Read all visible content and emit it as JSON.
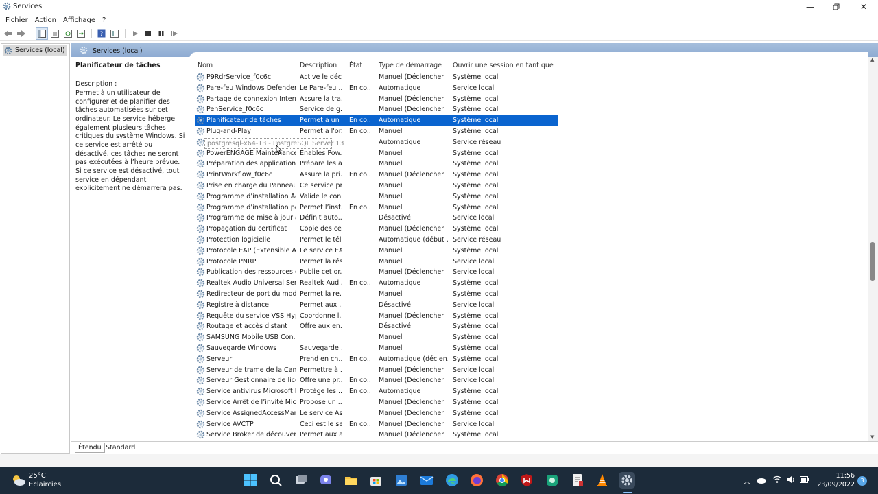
{
  "window": {
    "title": "Services"
  },
  "menu": [
    "Fichier",
    "Action",
    "Affichage",
    "?"
  ],
  "tree": {
    "node_label": "Services (local)"
  },
  "header_bar": {
    "label": "Services (local)"
  },
  "description_panel": {
    "title": "Planificateur de tâches",
    "desc_label": "Description :",
    "desc_text": "Permet à un utilisateur de configurer et de planifier des tâches automatisées sur cet ordinateur. Le service héberge également plusieurs tâches critiques du système Windows. Si ce service est arrêté ou désactivé, ces tâches ne seront pas exécutées à l’heure prévue. Si ce service est désactivé, tout service en dépendant explicitement ne démarrera pas."
  },
  "columns": [
    "Nom",
    "Description",
    "État",
    "Type de démarrage",
    "Ouvrir une session en tant que"
  ],
  "rows": [
    [
      "P9RdrService_f0c6c",
      "Active le déc...",
      "",
      "Manuel (Déclencher l...",
      "Système local"
    ],
    [
      "Pare-feu Windows Defender",
      "Le Pare-feu ...",
      "En co...",
      "Automatique",
      "Service local"
    ],
    [
      "Partage de connexion Intern...",
      "Assure la tra...",
      "",
      "Manuel (Déclencher l...",
      "Système local"
    ],
    [
      "PenService_f0c6c",
      "Service de g...",
      "",
      "Manuel (Déclencher l...",
      "Système local"
    ],
    [
      "Planificateur de tâches",
      "Permet à un ...",
      "En co...",
      "Automatique",
      "Système local"
    ],
    [
      "Plug-and-Play",
      "Permet à l'or...",
      "En co...",
      "Manuel",
      "Système local"
    ],
    [
      "",
      "",
      "",
      "Automatique",
      "Service réseau"
    ],
    [
      "PowerENGAGE Maintenance...",
      "Enables Pow...",
      "",
      "Manuel",
      "Système local"
    ],
    [
      "Préparation des applications",
      "Prépare les a...",
      "",
      "Manuel",
      "Système local"
    ],
    [
      "PrintWorkflow_f0c6c",
      "Assure la pri...",
      "En co...",
      "Manuel (Déclencher l...",
      "Système local"
    ],
    [
      "Prise en charge du Panneau ...",
      "Ce service pr...",
      "",
      "Manuel",
      "Système local"
    ],
    [
      "Programme d’installation Ac...",
      "Valide le con...",
      "",
      "Manuel",
      "Système local"
    ],
    [
      "Programme d’installation po...",
      "Permet l’inst...",
      "En co...",
      "Manuel",
      "Système local"
    ],
    [
      "Programme de mise à jour a...",
      "Définit auto...",
      "",
      "Désactivé",
      "Service local"
    ],
    [
      "Propagation du certificat",
      "Copie des ce...",
      "",
      "Manuel (Déclencher l...",
      "Système local"
    ],
    [
      "Protection logicielle",
      "Permet le tél...",
      "",
      "Automatique (début ...",
      "Service réseau"
    ],
    [
      "Protocole EAP (Extensible Au...",
      "Le service EA...",
      "",
      "Manuel",
      "Système local"
    ],
    [
      "Protocole PNRP",
      "Permet la rés...",
      "",
      "Manuel",
      "Service local"
    ],
    [
      "Publication des ressources d...",
      "Publie cet or...",
      "",
      "Manuel (Déclencher l...",
      "Service local"
    ],
    [
      "Realtek Audio Universal Serv...",
      "Realtek Audi...",
      "En co...",
      "Automatique",
      "Système local"
    ],
    [
      "Redirecteur de port du mod...",
      "Permet la re...",
      "",
      "Manuel",
      "Système local"
    ],
    [
      "Registre à distance",
      "Permet aux ...",
      "",
      "Désactivé",
      "Service local"
    ],
    [
      "Requête du service VSS Hyp...",
      "Coordonne l...",
      "",
      "Manuel (Déclencher l...",
      "Système local"
    ],
    [
      "Routage et accès distant",
      "Offre aux en...",
      "",
      "Désactivé",
      "Système local"
    ],
    [
      "SAMSUNG Mobile USB Con...",
      "",
      "",
      "Manuel",
      "Système local"
    ],
    [
      "Sauvegarde Windows",
      "Sauvegarde ...",
      "",
      "Manuel",
      "Système local"
    ],
    [
      "Serveur",
      "Prend en ch...",
      "En co...",
      "Automatique (déclen...",
      "Système local"
    ],
    [
      "Serveur de trame de la Camé...",
      "Permettre à ...",
      "",
      "Manuel (Déclencher l...",
      "Service local"
    ],
    [
      "Serveur Gestionnaire de lice...",
      "Offre une pr...",
      "En co...",
      "Manuel (Déclencher l...",
      "Service local"
    ],
    [
      "Service antivirus Microsoft D...",
      "Protège les ...",
      "En co...",
      "Automatique",
      "Système local"
    ],
    [
      "Service Arrêt de l’invité Micr...",
      "Propose un ...",
      "",
      "Manuel (Déclencher l...",
      "Système local"
    ],
    [
      "Service AssignedAccessMan...",
      "Le service As...",
      "",
      "Manuel (Déclencher l...",
      "Système local"
    ],
    [
      "Service AVCTP",
      "Ceci est le se...",
      "En co...",
      "Manuel (Déclencher l...",
      "Service local"
    ],
    [
      "Service Broker de découvert...",
      "Permet aux a...",
      "",
      "Manuel (Déclencher l...",
      "Système local"
    ]
  ],
  "selected_row_index": 4,
  "drag_ghost": "postgresql-x64-13 - PostgreSQL Server 13",
  "tabs": [
    "Étendu",
    "Standard"
  ],
  "taskbar": {
    "weather_temp": "25°C",
    "weather_cond": "Eclaircies",
    "time": "11:56",
    "date": "23/09/2022",
    "notif_count": "3"
  },
  "colors": {
    "selection": "#0a64cf",
    "header_bar": "#9bb6d8",
    "taskbar": "#1c2b3a"
  }
}
